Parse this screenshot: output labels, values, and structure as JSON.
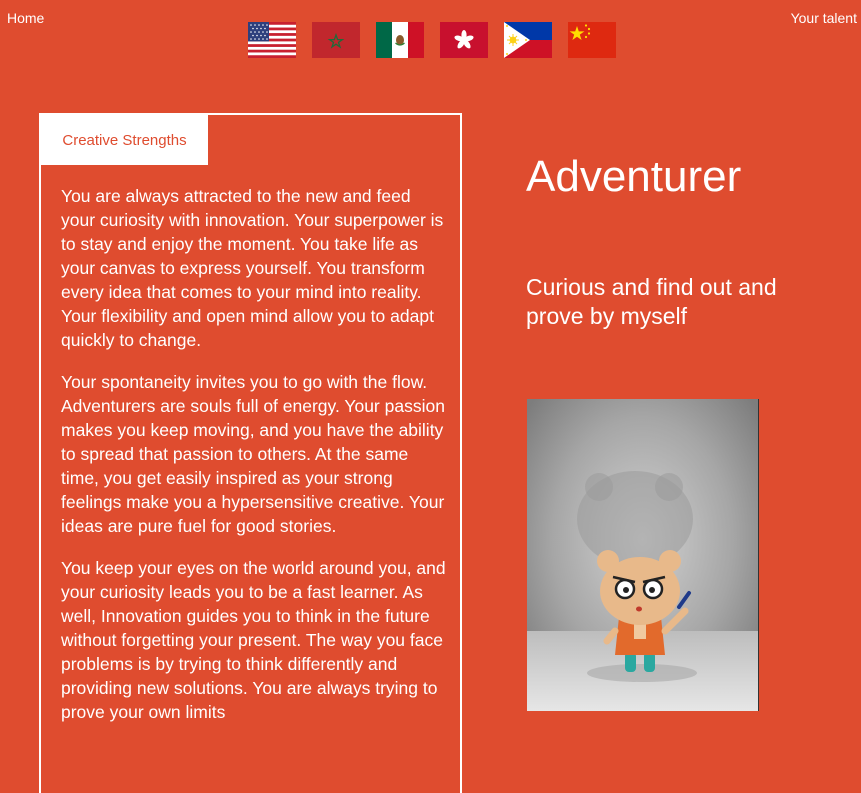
{
  "nav": {
    "home": "Home",
    "talent": "Your talent"
  },
  "flags": [
    {
      "name": "usa-flag-icon"
    },
    {
      "name": "morocco-flag-icon"
    },
    {
      "name": "mexico-flag-icon"
    },
    {
      "name": "hong-kong-flag-icon"
    },
    {
      "name": "philippines-flag-icon"
    },
    {
      "name": "china-flag-icon"
    }
  ],
  "card": {
    "tab_label": "Creative Strengths",
    "paragraphs": [
      "You are always attracted to the new and feed your curiosity with innovation. Your superpower is to stay and enjoy the moment. You take life as your canvas to express yourself. You transform every idea that comes to your mind into reality. Your flexibility and open mind allow you to adapt quickly to change.",
      "Your spontaneity invites you to go with the flow. Adventurers are souls full of energy. Your passion makes you keep moving, and you have the ability to spread that passion to others. At the same time, you get easily inspired as your strong feelings make you a hypersensitive creative. Your ideas are pure fuel for good stories.",
      "You keep your eyes on the world around you, and your curiosity leads you to be a fast learner. As well, Innovation guides you to think in the future without forgetting your present. The way you face problems is by trying to think differently and providing new solutions. You are always trying to prove your own limits"
    ]
  },
  "hero": {
    "title": "Adventurer",
    "subtitle": "Curious and find out and prove by myself"
  },
  "colors": {
    "background": "#df4c2f",
    "text": "#ffffff"
  }
}
